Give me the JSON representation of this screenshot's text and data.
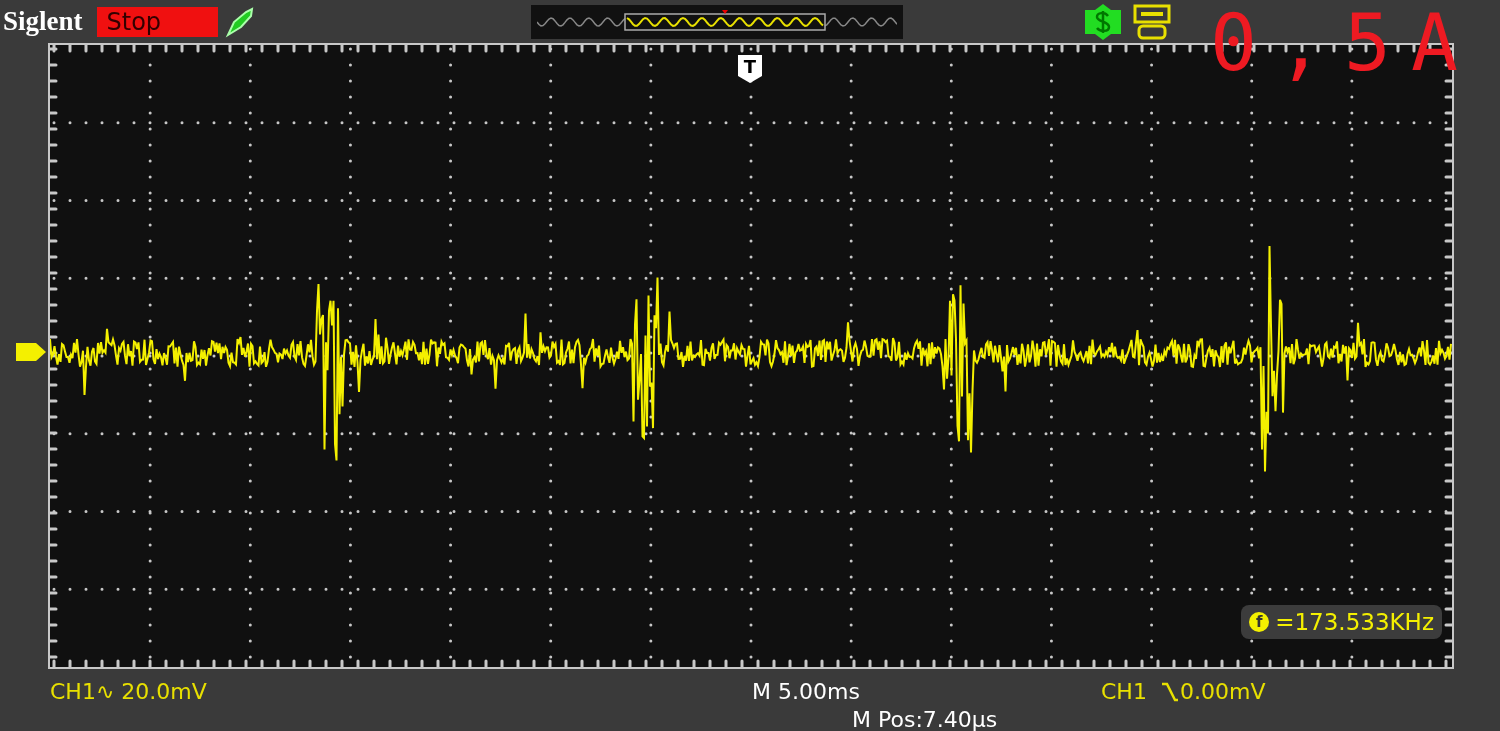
{
  "header": {
    "brand": "Siglent",
    "run_state": "Stop"
  },
  "annotation": "0,5A",
  "trigger_marker": "T",
  "measurement": {
    "label": "f",
    "value": "=173.533KHz"
  },
  "footer": {
    "channel_scale": "CH1∿ 20.0mV",
    "timebase": "M 5.00ms",
    "trigger_channel": "CH1",
    "trigger_level": "0.00mV",
    "horizontal_position": "M Pos:7.40μs"
  }
}
